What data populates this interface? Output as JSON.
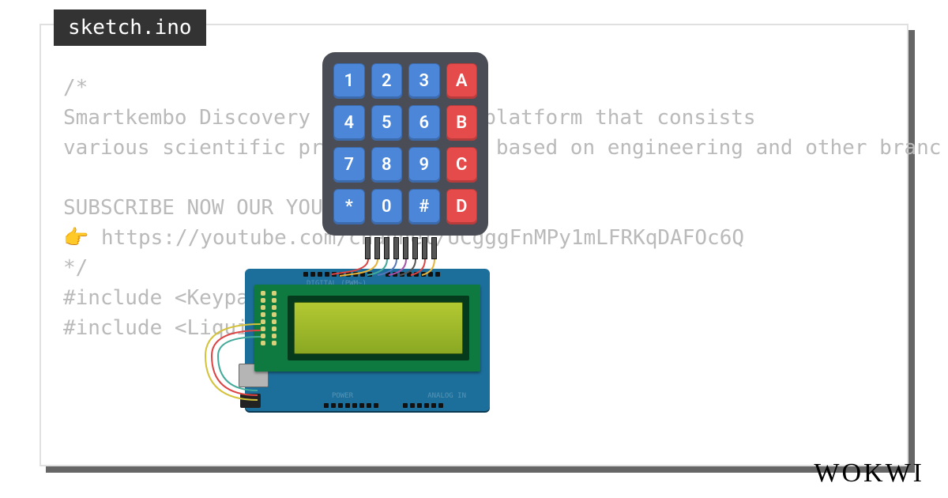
{
  "tab": {
    "filename": "sketch.ino"
  },
  "code": {
    "lines": [
      "/*",
      "Smartkembo Discovery Science is a platform that consists",
      "various scientific projects mostly based on engineering and other branc",
      "",
      "SUBSCRIBE NOW OUR YOUTUBE CHANNEL",
      "👉 https://youtube.com/channel/UCgggFnMPy1mLFRKqDAFOc6Q",
      "*/",
      "#include <Keypad.h>",
      "#include <LiquidCrystal_I2C.h"
    ]
  },
  "keypad": {
    "rows": [
      [
        {
          "label": "1",
          "color": "blue"
        },
        {
          "label": "2",
          "color": "blue"
        },
        {
          "label": "3",
          "color": "blue"
        },
        {
          "label": "A",
          "color": "red"
        }
      ],
      [
        {
          "label": "4",
          "color": "blue"
        },
        {
          "label": "5",
          "color": "blue"
        },
        {
          "label": "6",
          "color": "blue"
        },
        {
          "label": "B",
          "color": "red"
        }
      ],
      [
        {
          "label": "7",
          "color": "blue"
        },
        {
          "label": "8",
          "color": "blue"
        },
        {
          "label": "9",
          "color": "blue"
        },
        {
          "label": "C",
          "color": "red"
        }
      ],
      [
        {
          "label": "*",
          "color": "blue"
        },
        {
          "label": "0",
          "color": "blue"
        },
        {
          "label": "#",
          "color": "blue"
        },
        {
          "label": "D",
          "color": "red"
        }
      ]
    ]
  },
  "brand": {
    "logo_text": "WOKWI"
  },
  "colors": {
    "keypad_body": "#4a4d55",
    "key_blue": "#4c86d9",
    "key_red": "#e64b4b",
    "arduino": "#1d6f9b",
    "lcd_shield": "#0e7a3f",
    "lcd_screen": "#a8bf2a"
  }
}
